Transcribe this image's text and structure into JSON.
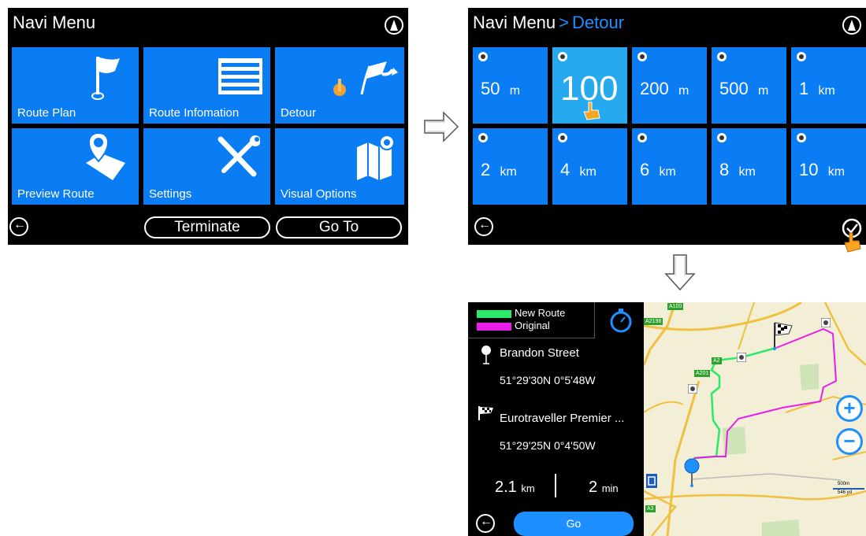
{
  "panel1": {
    "title": "Navi Menu",
    "tiles": [
      {
        "label": "Route Plan",
        "icon": "flag-icon"
      },
      {
        "label": "Route Infomation",
        "icon": "list-icon"
      },
      {
        "label": "Detour",
        "icon": "detour-flags-icon"
      },
      {
        "label": "Preview Route",
        "icon": "preview-pin-icon"
      },
      {
        "label": "Settings",
        "icon": "tools-icon"
      },
      {
        "label": "Visual Options",
        "icon": "map-icon"
      }
    ],
    "terminate_label": "Terminate",
    "goto_label": "Go To"
  },
  "panel2": {
    "title": "Navi Menu",
    "separator": ">",
    "subtitle": "Detour",
    "options": [
      {
        "value": "50",
        "unit": "m"
      },
      {
        "value": "100",
        "unit": "m",
        "selected": true
      },
      {
        "value": "200",
        "unit": "m"
      },
      {
        "value": "500",
        "unit": "m"
      },
      {
        "value": "1",
        "unit": "km"
      },
      {
        "value": "2",
        "unit": "km"
      },
      {
        "value": "4",
        "unit": "km"
      },
      {
        "value": "6",
        "unit": "km"
      },
      {
        "value": "8",
        "unit": "km"
      },
      {
        "value": "10",
        "unit": "km"
      }
    ]
  },
  "panel3": {
    "legend_new": "New Route",
    "legend_original": "Original",
    "legend_new_color": "#2ee86a",
    "legend_original_color": "#e81ee8",
    "start_name": "Brandon Street",
    "start_coords": "51°29'30N  0°5'48W",
    "dest_name": "Eurotraveller Premier ...",
    "dest_coords": "51°29'25N  0°4'50W",
    "distance_value": "2.1",
    "distance_unit": "km",
    "time_value": "2",
    "time_unit": "min",
    "go_label": "Go",
    "map_labels": {
      "a100": "A100",
      "a2198": "A2198",
      "a2": "A2",
      "a201": "A201",
      "a3": "A3",
      "scale_m": "500m",
      "scale_yd": "546 yd"
    }
  },
  "colors": {
    "tile_blue": "#0a7cf4",
    "selected_blue": "#26a9ee",
    "accent": "#1e8fff"
  }
}
